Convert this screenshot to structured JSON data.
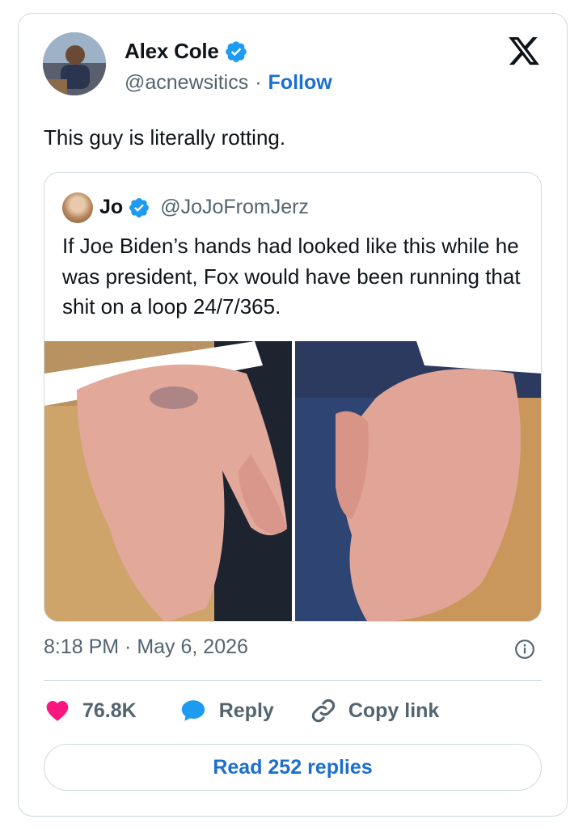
{
  "author": {
    "name": "Alex Cole",
    "handle": "@acnewsitics",
    "separator": "·",
    "follow_label": "Follow",
    "verified": true
  },
  "tweet": {
    "text": "This guy is literally rotting."
  },
  "quoted": {
    "name": "Jo",
    "handle": "@JoJoFromJerz",
    "verified": true,
    "text": "If Joe Biden’s hands had looked like this while he was president, Fox would have been running that shit on a loop 24/7/365."
  },
  "meta": {
    "time": "8:18 PM · May 6, 2026"
  },
  "actions": {
    "likes": "76.8K",
    "reply_label": "Reply",
    "copy_label": "Copy link"
  },
  "read_replies_label": "Read 252 replies",
  "colors": {
    "accent": "#1d6fcf",
    "heart": "#f91880",
    "verified": "#1d9bf0",
    "secondary_text": "#536471",
    "border": "#cfd9de"
  },
  "icons": [
    "x-logo-icon",
    "verified-badge-icon",
    "heart-icon",
    "reply-bubble-icon",
    "link-icon",
    "info-icon"
  ]
}
